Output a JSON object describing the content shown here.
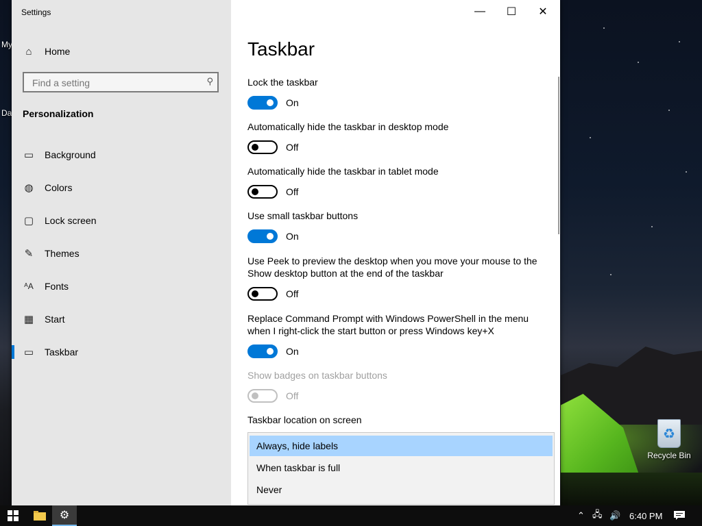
{
  "desktop": {
    "icon_labels": [
      "My",
      "Da"
    ],
    "recycle_bin_label": "Recycle Bin"
  },
  "window": {
    "app_title": "Settings",
    "controls": {
      "minimize": "—",
      "maximize": "☐",
      "close": "✕"
    }
  },
  "sidebar": {
    "home_label": "Home",
    "search_placeholder": "Find a setting",
    "section_title": "Personalization",
    "items": [
      {
        "label": "Background",
        "icon": "image-icon"
      },
      {
        "label": "Colors",
        "icon": "palette-icon"
      },
      {
        "label": "Lock screen",
        "icon": "lock-screen-icon"
      },
      {
        "label": "Themes",
        "icon": "brush-icon"
      },
      {
        "label": "Fonts",
        "icon": "font-icon"
      },
      {
        "label": "Start",
        "icon": "start-grid-icon"
      },
      {
        "label": "Taskbar",
        "icon": "taskbar-icon",
        "active": true
      }
    ]
  },
  "main": {
    "page_title": "Taskbar",
    "settings": [
      {
        "label": "Lock the taskbar",
        "state": "On"
      },
      {
        "label": "Automatically hide the taskbar in desktop mode",
        "state": "Off"
      },
      {
        "label": "Automatically hide the taskbar in tablet mode",
        "state": "Off"
      },
      {
        "label": "Use small taskbar buttons",
        "state": "On"
      },
      {
        "label": "Use Peek to preview the desktop when you move your mouse to the Show desktop button at the end of the taskbar",
        "state": "Off"
      },
      {
        "label": "Replace Command Prompt with Windows PowerShell in the menu when I right-click the start button or press Windows key+X",
        "state": "On"
      },
      {
        "label": "Show badges on taskbar buttons",
        "state": "Off",
        "disabled": true
      }
    ],
    "location_label": "Taskbar location on screen",
    "dropdown_options": [
      {
        "label": "Always, hide labels",
        "selected": true
      },
      {
        "label": "When taskbar is full"
      },
      {
        "label": "Never"
      }
    ]
  },
  "taskbar": {
    "clock": "6:40 PM"
  },
  "colors": {
    "accent": "#0078d7",
    "selected_option": "#a8d4ff"
  }
}
